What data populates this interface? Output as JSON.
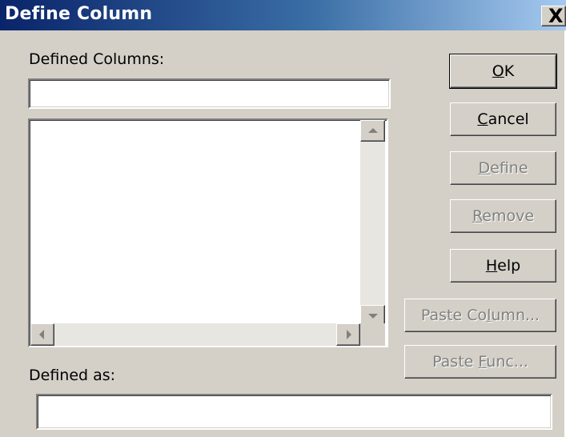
{
  "window": {
    "title": "Define Column",
    "close_symbol": "X"
  },
  "labels": {
    "defined_columns": "Defined Columns:",
    "defined_as": "Defined as:"
  },
  "inputs": {
    "column_name_value": "",
    "definition_value": ""
  },
  "listbox": {
    "items": []
  },
  "buttons": {
    "ok": {
      "pre": "",
      "key": "O",
      "post": "K",
      "enabled": true,
      "default": true
    },
    "cancel": {
      "pre": "",
      "key": "C",
      "post": "ancel",
      "enabled": true
    },
    "define": {
      "pre": "",
      "key": "D",
      "post": "efine",
      "enabled": false
    },
    "remove": {
      "pre": "",
      "key": "R",
      "post": "emove",
      "enabled": false
    },
    "help": {
      "pre": "",
      "key": "H",
      "post": "elp",
      "enabled": true
    },
    "paste_column": {
      "pre": "Paste Co",
      "key": "l",
      "post": "umn...",
      "enabled": false
    },
    "paste_func": {
      "pre": "Paste ",
      "key": "F",
      "post": "unc...",
      "enabled": false
    }
  },
  "icons": [
    "close-icon",
    "scroll-up-icon",
    "scroll-down-icon",
    "scroll-left-icon",
    "scroll-right-icon"
  ],
  "colors": {
    "face": "#d4d0c8",
    "title_start": "#0a246a",
    "title_end": "#a6caf0",
    "disabled_text": "#808080"
  }
}
